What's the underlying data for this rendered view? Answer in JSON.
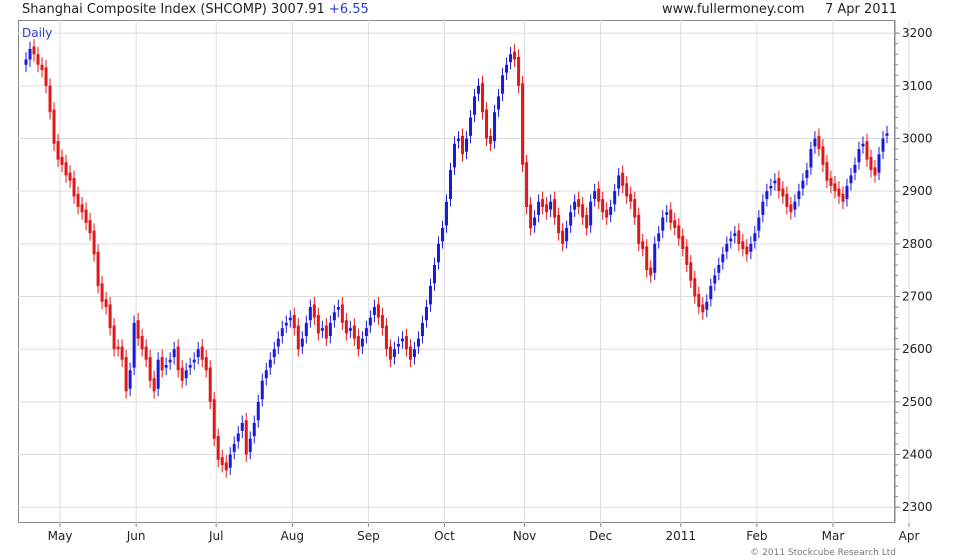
{
  "header": {
    "title": "Shanghai Composite Index (SHCOMP)",
    "last": "3007.91",
    "change": "+6.55",
    "site": "www.fullermoney.com",
    "date": "7 Apr 2011"
  },
  "period_label": "Daily",
  "copyright": "© 2011 Stockcube Research Ltd",
  "colors": {
    "up": "#1a1adc",
    "down": "#e01818",
    "grid": "#dcdcdc",
    "axis": "#888888"
  },
  "chart_data": {
    "type": "candlestick",
    "ylim": [
      2270,
      3225
    ],
    "y_ticks": [
      2300,
      2400,
      2500,
      2600,
      2700,
      2800,
      2900,
      3000,
      3100,
      3200
    ],
    "grid": true,
    "x_labels": [
      {
        "label": "May",
        "index": 9
      },
      {
        "label": "Jun",
        "index": 28
      },
      {
        "label": "Jul",
        "index": 48
      },
      {
        "label": "Aug",
        "index": 67
      },
      {
        "label": "Sep",
        "index": 86
      },
      {
        "label": "Oct",
        "index": 105
      },
      {
        "label": "Nov",
        "index": 125
      },
      {
        "label": "Dec",
        "index": 144
      },
      {
        "label": "2011",
        "index": 164
      },
      {
        "label": "Feb",
        "index": 183
      },
      {
        "label": "Mar",
        "index": 202
      },
      {
        "label": "Apr",
        "index": 221
      }
    ],
    "closes": [
      3150,
      3170,
      3160,
      3140,
      3130,
      3100,
      3050,
      2990,
      2960,
      2950,
      2930,
      2920,
      2890,
      2870,
      2860,
      2840,
      2820,
      2780,
      2720,
      2690,
      2680,
      2640,
      2600,
      2600,
      2580,
      2520,
      2560,
      2650,
      2620,
      2600,
      2580,
      2540,
      2520,
      2580,
      2560,
      2570,
      2580,
      2600,
      2560,
      2540,
      2560,
      2570,
      2580,
      2600,
      2580,
      2560,
      2500,
      2430,
      2390,
      2380,
      2370,
      2400,
      2420,
      2440,
      2460,
      2400,
      2430,
      2460,
      2500,
      2540,
      2560,
      2580,
      2600,
      2620,
      2640,
      2650,
      2660,
      2640,
      2600,
      2620,
      2650,
      2680,
      2660,
      2630,
      2640,
      2620,
      2650,
      2670,
      2680,
      2650,
      2630,
      2640,
      2620,
      2600,
      2620,
      2640,
      2660,
      2680,
      2660,
      2640,
      2600,
      2580,
      2600,
      2610,
      2620,
      2600,
      2580,
      2600,
      2620,
      2650,
      2680,
      2720,
      2760,
      2800,
      2830,
      2880,
      2940,
      2990,
      3000,
      2970,
      3000,
      3040,
      3080,
      3100,
      3050,
      3000,
      2990,
      3050,
      3080,
      3120,
      3140,
      3160,
      3150,
      3100,
      2950,
      2870,
      2830,
      2850,
      2880,
      2870,
      2860,
      2880,
      2850,
      2820,
      2800,
      2830,
      2860,
      2880,
      2870,
      2850,
      2830,
      2880,
      2900,
      2880,
      2860,
      2850,
      2870,
      2900,
      2930,
      2910,
      2890,
      2880,
      2850,
      2800,
      2790,
      2750,
      2740,
      2800,
      2820,
      2850,
      2860,
      2840,
      2830,
      2810,
      2790,
      2760,
      2730,
      2700,
      2680,
      2670,
      2690,
      2720,
      2740,
      2760,
      2780,
      2800,
      2810,
      2820,
      2800,
      2790,
      2780,
      2800,
      2820,
      2850,
      2880,
      2900,
      2910,
      2920,
      2900,
      2890,
      2870,
      2860,
      2880,
      2900,
      2920,
      2940,
      2980,
      3000,
      2980,
      2950,
      2920,
      2910,
      2900,
      2890,
      2880,
      2910,
      2930,
      2950,
      2980,
      2990,
      2960,
      2940,
      2930,
      2970,
      3000,
      3010
    ],
    "opens": [
      3140,
      3150,
      3175,
      3160,
      3140,
      3135,
      3100,
      3055,
      2995,
      2965,
      2955,
      2935,
      2925,
      2895,
      2875,
      2865,
      2845,
      2825,
      2785,
      2725,
      2695,
      2685,
      2645,
      2605,
      2605,
      2585,
      2525,
      2565,
      2655,
      2625,
      2605,
      2585,
      2545,
      2525,
      2585,
      2565,
      2575,
      2585,
      2605,
      2565,
      2545,
      2565,
      2575,
      2585,
      2605,
      2585,
      2565,
      2505,
      2435,
      2395,
      2385,
      2375,
      2405,
      2425,
      2445,
      2465,
      2405,
      2435,
      2465,
      2505,
      2545,
      2565,
      2585,
      2605,
      2625,
      2645,
      2655,
      2665,
      2645,
      2605,
      2625,
      2655,
      2685,
      2665,
      2635,
      2645,
      2625,
      2655,
      2675,
      2685,
      2655,
      2635,
      2645,
      2625,
      2605,
      2625,
      2645,
      2665,
      2685,
      2665,
      2645,
      2605,
      2585,
      2605,
      2615,
      2625,
      2605,
      2585,
      2605,
      2625,
      2655,
      2685,
      2725,
      2765,
      2805,
      2835,
      2885,
      2945,
      2995,
      3005,
      2975,
      3005,
      3045,
      3085,
      3105,
      3055,
      3005,
      2995,
      3055,
      3085,
      3125,
      3145,
      3165,
      3155,
      3105,
      2955,
      2875,
      2835,
      2855,
      2885,
      2875,
      2865,
      2885,
      2855,
      2825,
      2805,
      2835,
      2865,
      2885,
      2875,
      2855,
      2835,
      2885,
      2905,
      2885,
      2865,
      2855,
      2875,
      2905,
      2935,
      2915,
      2895,
      2885,
      2855,
      2805,
      2795,
      2755,
      2745,
      2805,
      2825,
      2855,
      2865,
      2845,
      2835,
      2815,
      2795,
      2765,
      2735,
      2705,
      2685,
      2675,
      2695,
      2725,
      2745,
      2765,
      2785,
      2805,
      2815,
      2825,
      2805,
      2795,
      2785,
      2805,
      2825,
      2855,
      2885,
      2905,
      2915,
      2925,
      2905,
      2895,
      2875,
      2865,
      2885,
      2905,
      2925,
      2945,
      2985,
      3005,
      2985,
      2955,
      2925,
      2915,
      2905,
      2895,
      2885,
      2915,
      2935,
      2955,
      2985,
      2995,
      2965,
      2945,
      2935,
      2975,
      3005
    ]
  }
}
